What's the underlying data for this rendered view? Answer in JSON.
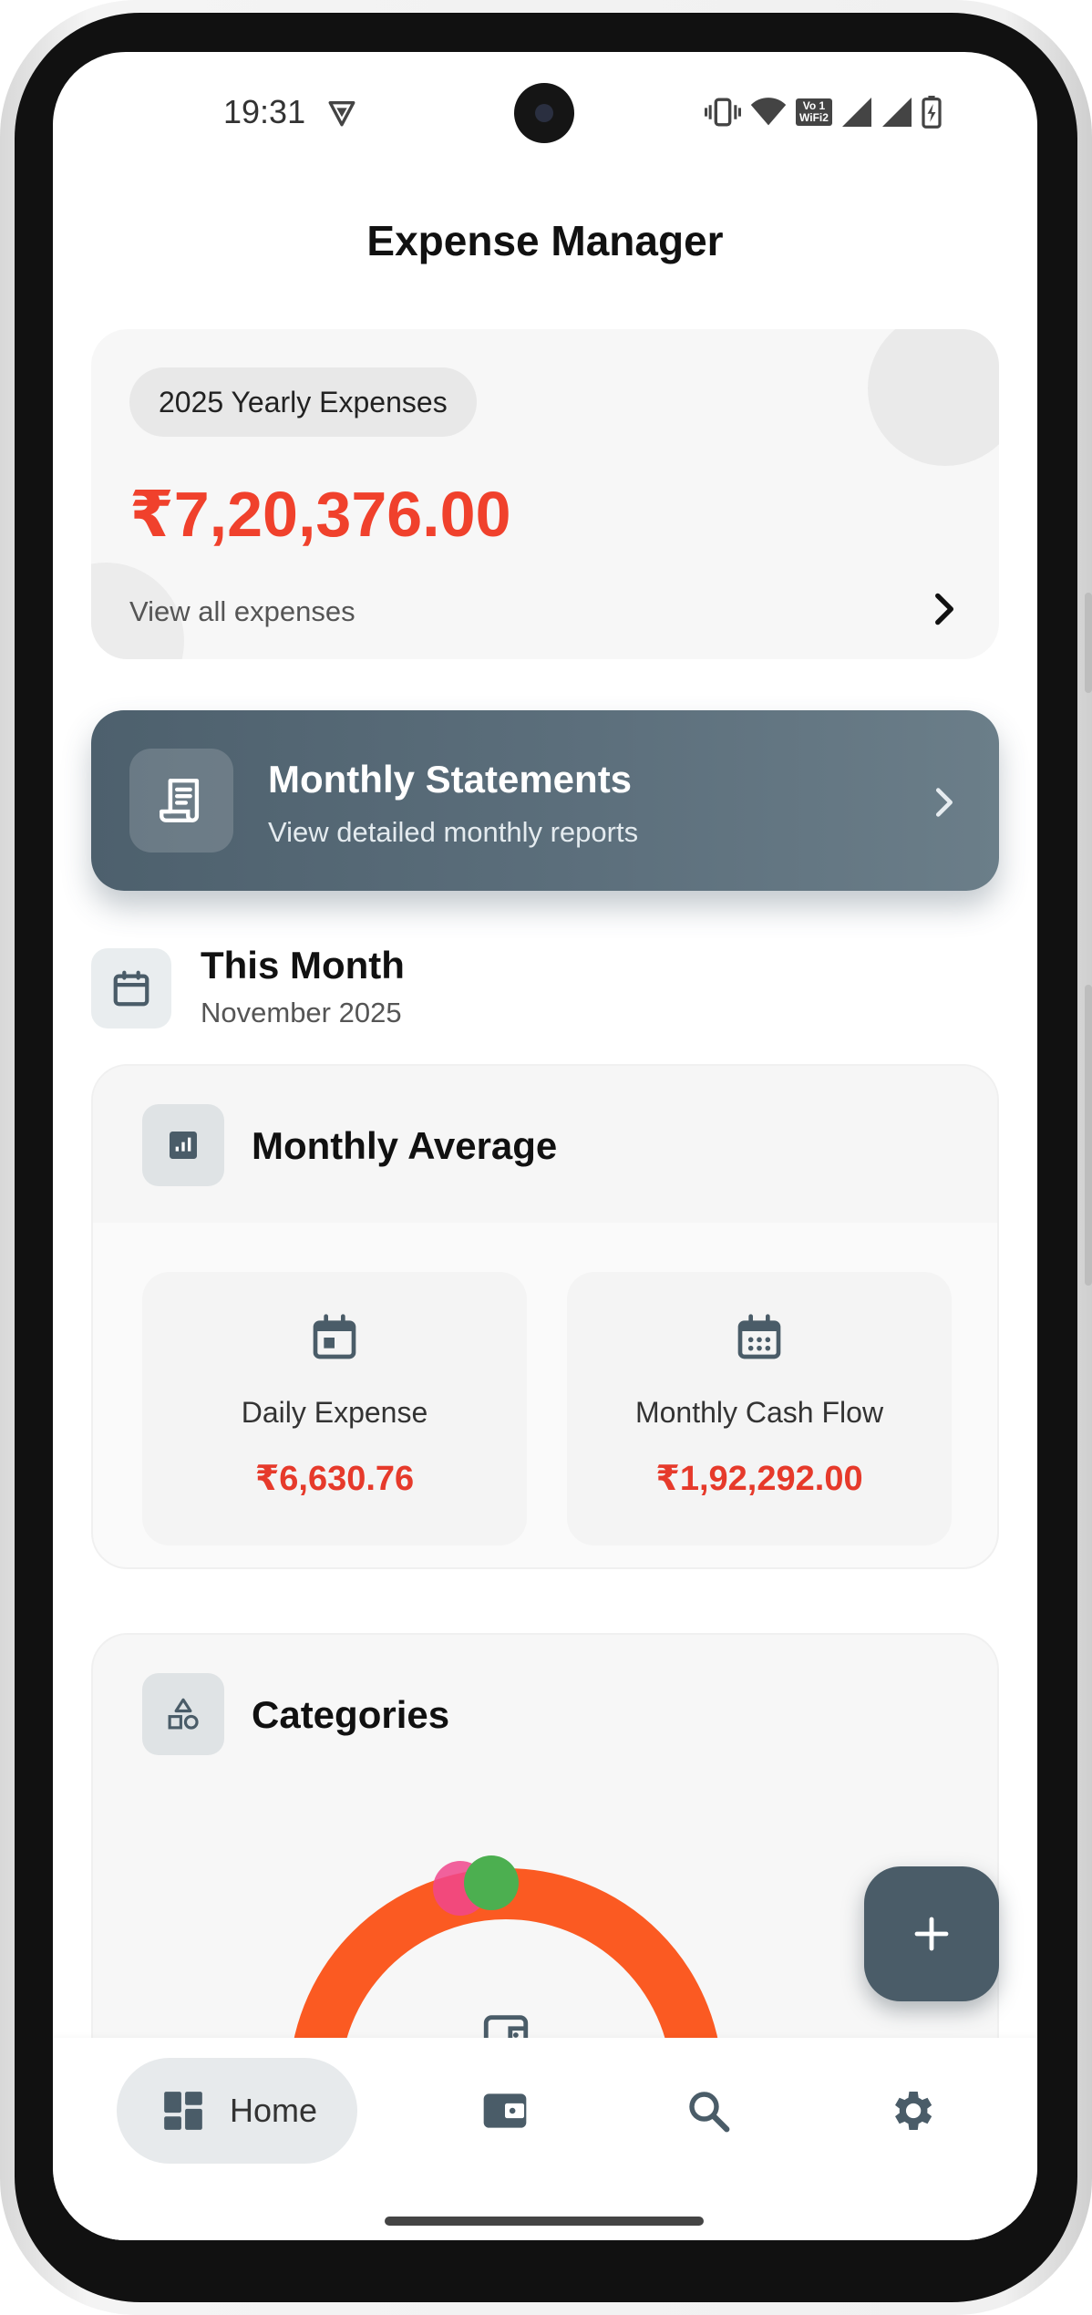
{
  "status_bar": {
    "time": "19:31",
    "network_badge_top": "Vo",
    "network_badge_bottom": "WiFi2",
    "network_badge_digit": "1"
  },
  "header": {
    "title": "Expense Manager"
  },
  "yearly_card": {
    "badge": "2025 Yearly Expenses",
    "amount": "₹7,20,376.00",
    "link": "View all expenses",
    "accent_color": "#f0412c"
  },
  "statements_card": {
    "title": "Monthly Statements",
    "subtitle": "View detailed monthly reports",
    "icon": "receipt-icon"
  },
  "this_month": {
    "title": "This Month",
    "subtitle": "November 2025",
    "icon": "calendar-icon"
  },
  "monthly_average": {
    "title": "Monthly Average",
    "icon": "bar-chart-icon",
    "tiles": [
      {
        "label": "Daily Expense",
        "value": "₹6,630.76",
        "icon": "calendar-today-icon"
      },
      {
        "label": "Monthly Cash Flow",
        "value": "₹1,92,292.00",
        "icon": "calendar-month-icon"
      }
    ]
  },
  "categories": {
    "title": "Categories",
    "icon": "category-shapes-icon",
    "center_icon": "wallet-icon",
    "segment_colors": [
      "#fb5a22",
      "#f0468c",
      "#4caf50"
    ]
  },
  "fab": {
    "icon": "plus-icon"
  },
  "bottom_nav": {
    "items": [
      {
        "label": "Home",
        "icon": "dashboard-icon",
        "active": true
      },
      {
        "label": "",
        "icon": "wallet-icon",
        "active": false
      },
      {
        "label": "",
        "icon": "search-icon",
        "active": false
      },
      {
        "label": "",
        "icon": "settings-icon",
        "active": false
      }
    ]
  }
}
